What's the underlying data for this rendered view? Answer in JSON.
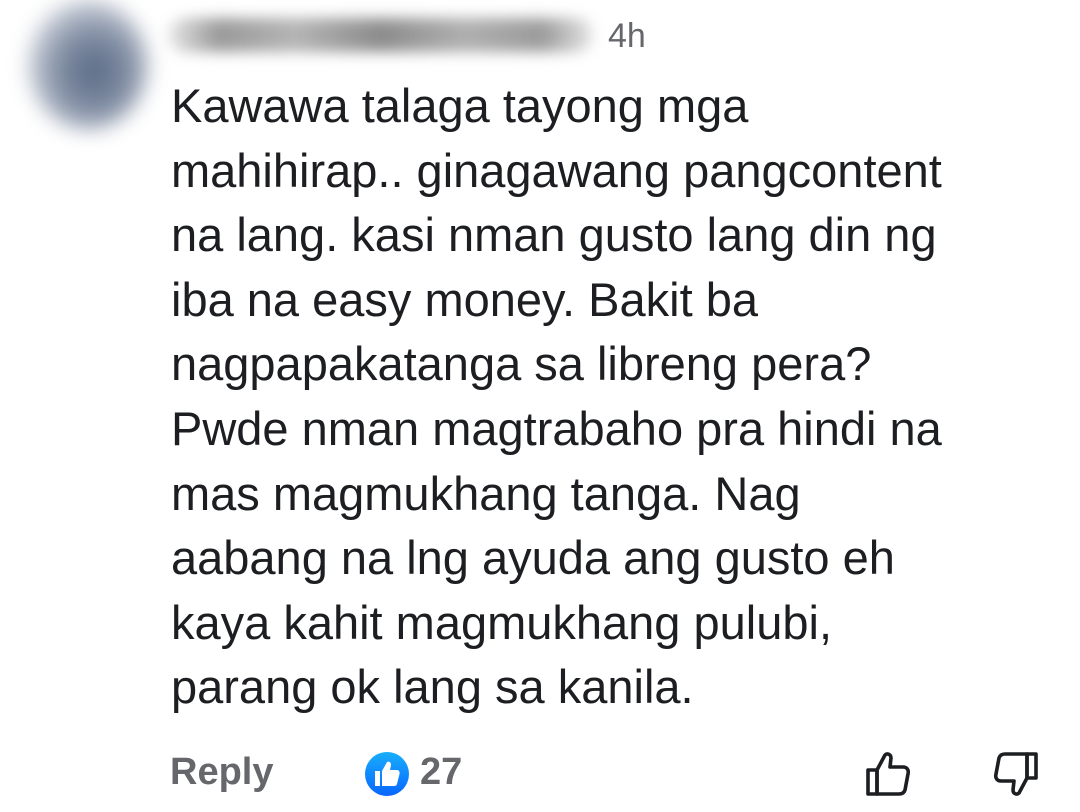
{
  "comment": {
    "author_name": "",
    "timestamp": "4h",
    "lines": [
      "Kawawa talaga tayong mga",
      "mahihirap.. ginagawang pangcontent",
      "na lang. kasi nman gusto lang din ng",
      "iba na easy money. Bakit ba",
      "nagpapakatanga sa libreng pera?",
      "Pwde nman magtrabaho pra hindi na",
      "mas magmukhang tanga. Nag",
      "aabang na lng ayuda ang gusto eh",
      "kaya kahit magmukhang pulubi,",
      "parang ok lang sa kanila."
    ]
  },
  "actions": {
    "reply_label": "Reply",
    "reaction_icon": "like-reaction-icon",
    "reaction_count": "27",
    "like_icon": "thumbs-up-outline-icon",
    "dislike_icon": "thumbs-down-outline-icon"
  },
  "colors": {
    "text": "#1c1e21",
    "secondary_text": "#65676b",
    "like_blue": "#0866ff",
    "background": "#ffffff"
  }
}
